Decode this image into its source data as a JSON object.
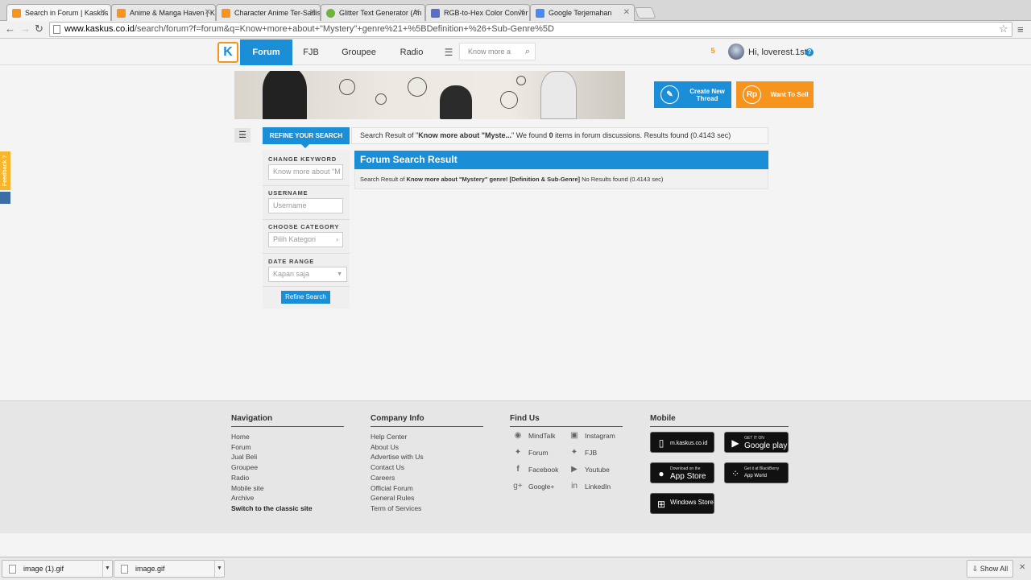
{
  "browser": {
    "tabs": [
      {
        "title": "Search in Forum | Kaskus",
        "favicon_color": "#f7941d",
        "active": true
      },
      {
        "title": "Anime & Manga Haven | Ka",
        "favicon_color": "#f7941d",
        "active": false
      },
      {
        "title": "Character Anime Ter-Sadis",
        "favicon_color": "#f7941d",
        "active": false
      },
      {
        "title": "Glitter Text Generator (An",
        "favicon_color": "#6fb33b",
        "active": false
      },
      {
        "title": "RGB-to-Hex Color Conver",
        "favicon_color": "#5a6ec8",
        "active": false
      },
      {
        "title": "Google Terjemahan",
        "favicon_color": "#4a8af4",
        "active": false
      }
    ],
    "url_domain": "www.kaskus.co.id",
    "url_path": "/search/forum?f=forum&q=Know+more+about+\"Mystery\"+genre%21+%5BDefinition+%26+Sub-Genre%5D"
  },
  "site": {
    "logo": "K",
    "nav": [
      "Forum",
      "FJB",
      "Groupee",
      "Radio"
    ],
    "search_placeholder": "Know more a",
    "notification_count": "5",
    "greeting": "Hi, loverest.1st",
    "help": "?"
  },
  "actions": {
    "create_thread": "Create New Thread",
    "want_to_sell": "Want To Sell",
    "rp": "Rp"
  },
  "refine": {
    "tab_label": "REFINE YOUR SEARCH",
    "keyword_label": "CHANGE KEYWORD",
    "keyword_value": "Know more about \"M",
    "username_label": "USERNAME",
    "username_placeholder": "Username",
    "category_label": "CHOOSE CATEGORY",
    "category_value": "Pilih Kategori",
    "date_label": "DATE RANGE",
    "date_value": "Kapan saja",
    "button": "Refine Search"
  },
  "summary": {
    "prefix": "Search Result of \"",
    "query": "Know more about \"Myste...",
    "mid": "\" We found ",
    "count": "0",
    "suffix": " items in forum discussions. Results found (0.4143 sec)"
  },
  "results": {
    "title": "Forum Search Result",
    "prefix": "Search Result of ",
    "query": "Know more about \"Mystery\" genre! [Definition & Sub-Genre]",
    "suffix": " No Results found (0.4143 sec)"
  },
  "feedback": "Feedback ?",
  "footer": {
    "navigation": {
      "title": "Navigation",
      "items": [
        "Home",
        "Forum",
        "Jual Beli",
        "Groupee",
        "Radio",
        "Mobile site",
        "Archive",
        "Switch to the classic site"
      ]
    },
    "company": {
      "title": "Company Info",
      "items": [
        "Help Center",
        "About Us",
        "Advertise with Us",
        "Contact Us",
        "Careers",
        "Official Forum",
        "General Rules",
        "Term of Services"
      ]
    },
    "find_us": {
      "title": "Find Us",
      "items": [
        "MindTalk",
        "Instagram",
        "Forum",
        "FJB",
        "Facebook",
        "Youtube",
        "Google+",
        "LinkedIn"
      ]
    },
    "mobile": {
      "title": "Mobile",
      "stores": [
        {
          "small": "",
          "big": "m.kaskus.co.id",
          "icon": "phone-icon"
        },
        {
          "small": "GET IT ON",
          "big": "Google play",
          "icon": "google-play-icon"
        },
        {
          "small": "Download on the",
          "big": "App Store",
          "icon": "apple-icon"
        },
        {
          "small": "Get it at BlackBerry",
          "big": "App World",
          "icon": "blackberry-icon"
        },
        {
          "small": "",
          "big": "Windows Store",
          "icon": "windows-icon"
        }
      ]
    }
  },
  "downloads": {
    "items": [
      "image (1).gif",
      "image.gif"
    ],
    "show_all": "Show All"
  },
  "colors": {
    "brand_blue": "#1a8fd8",
    "brand_orange": "#f7941d"
  }
}
